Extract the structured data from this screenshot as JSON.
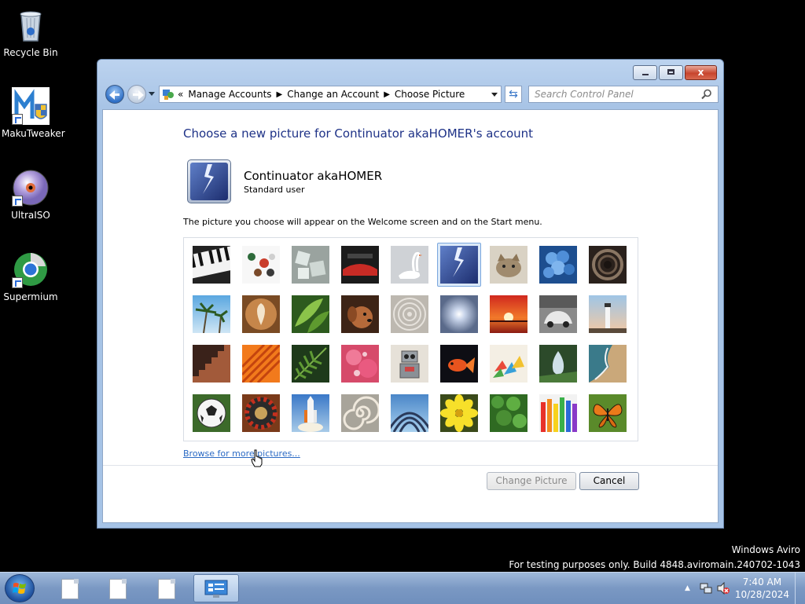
{
  "desktop": {
    "icons": [
      {
        "label": "Recycle Bin"
      },
      {
        "label": "MakuTweaker"
      },
      {
        "label": "UltraISO"
      },
      {
        "label": "Supermium"
      }
    ]
  },
  "window": {
    "breadcrumb": [
      "Manage Accounts",
      "Change an Account",
      "Choose Picture"
    ],
    "breadcrumb_prefix": "«",
    "search_placeholder": "Search Control Panel",
    "close_label": "x",
    "headline": "Choose a new picture for Continuator akaHOMER's account",
    "account": {
      "name": "Continuator akaHOMER",
      "type": "Standard user"
    },
    "description": "The picture you choose will appear on the Welcome screen and on the Start menu.",
    "browse_link": "Browse for more pictures...",
    "buttons": {
      "change": "Change Picture",
      "cancel": "Cancel"
    },
    "selected_index": 5,
    "pictures": [
      "piano-keys",
      "bowls",
      "ice-cubes",
      "red-car-interior",
      "swan",
      "lightning",
      "kitten",
      "hydrangea",
      "spiral-stairs",
      "palm-trees",
      "latte-art",
      "green-leaves",
      "dog",
      "sand-spiral",
      "sun-sky",
      "sunset",
      "beetle-car",
      "lighthouse",
      "stairs",
      "orange-flower",
      "fern-leaf",
      "pink-flower",
      "robot",
      "goldfish",
      "origami-cranes",
      "water-drop",
      "coast",
      "soccer-ball",
      "roulette",
      "space-shuttle",
      "nautilus-shell",
      "steel-arches",
      "yellow-flower",
      "shrub",
      "crayons",
      "butterfly"
    ]
  },
  "watermark": {
    "line1": "Windows Aviro",
    "line2": "For testing purposes only. Build 4848.aviromain.240702-1043"
  },
  "taskbar": {
    "time": "7:40 AM",
    "date": "10/28/2024"
  }
}
